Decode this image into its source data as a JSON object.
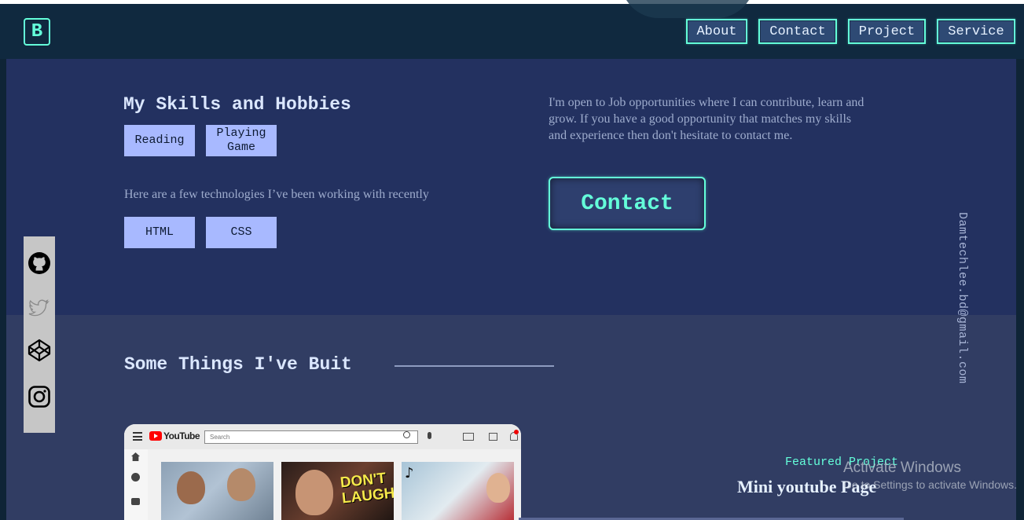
{
  "nav": {
    "logo": "B",
    "links": [
      "About",
      "Contact",
      "Project",
      "Service"
    ]
  },
  "skills": {
    "title": "My Skills and Hobbies",
    "hobbies": [
      "Reading",
      "Playing Game"
    ],
    "tech_intro": "Here are a few technologies I’ve been working with recently",
    "technologies": [
      "HTML",
      "CSS"
    ]
  },
  "contact": {
    "text": "I'm open to Job opportunities where I can contribute, learn and grow. If you have a good opportunity that matches my skills and experience then don't hesitate to contact me.",
    "button_label": "Contact"
  },
  "email": "Damtechlee.bd@gmail.com",
  "social": {
    "icons": [
      "github-icon",
      "twitter-icon",
      "codepen-icon",
      "instagram-icon"
    ],
    "bar_color": "#c6c6c6"
  },
  "built": {
    "title": "Some Things I've Buit",
    "featured_label": "Featured Project",
    "project_title": "Mini youtube Page",
    "preview": {
      "logo_text": "YouTube",
      "search_placeholder": "Search",
      "thumb_text": "DON'T LAUGH"
    }
  },
  "windows_watermark": {
    "title": "Activate Windows",
    "subtitle": "Go to Settings to activate Windows."
  },
  "colors": {
    "accent": "#64ffda",
    "nav_bg": "#10293f",
    "skills_bg": "#233160",
    "built_bg": "#313d63",
    "chip_bg": "#a8b9ff"
  }
}
